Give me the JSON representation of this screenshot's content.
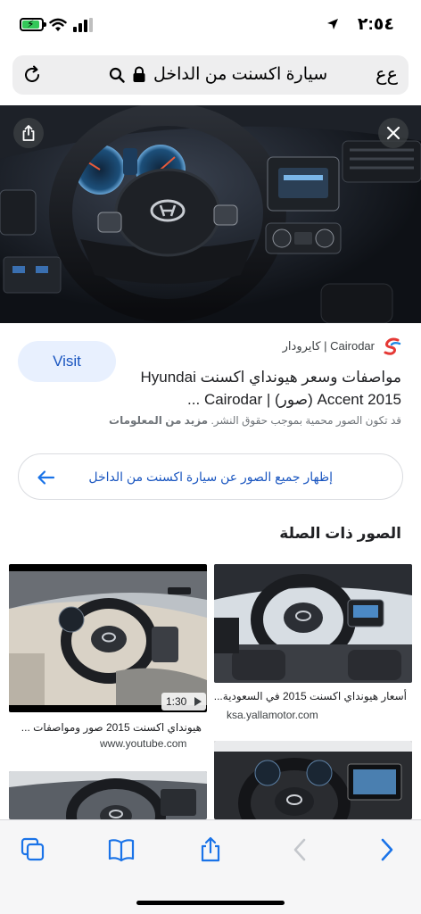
{
  "status_bar": {
    "time": "٢:٥٤",
    "icons": [
      "location-arrow-icon",
      "battery-charging-icon",
      "wifi-icon",
      "cellular-signal-icon"
    ]
  },
  "url_bar": {
    "text_size_label": "ﻉﻉ",
    "query": "سيارة اكسنت من الداخل",
    "icons": [
      "lock-icon",
      "search-icon",
      "reload-icon"
    ]
  },
  "hero": {
    "description_icons": [
      "share-icon",
      "close-icon"
    ]
  },
  "result": {
    "source_name": "Cairodar | كايرودار",
    "title_line1": "مواصفات وسعر هيونداي اكسنت Hyundai",
    "title_line2": "Accent 2015 (صور) | Cairodar ...",
    "copyright_text": "قد تكون الصور محمية بموجب حقوق النشر.",
    "more_info": "مزيد من المعلومات",
    "visit_label": "Visit"
  },
  "show_all": {
    "label": "إظهار جميع الصور عن سيارة اكسنت من الداخل"
  },
  "related": {
    "heading": "الصور ذات الصلة",
    "items": [
      {
        "title": "أسعار هيونداي اكسنت 2015 في السعودية...",
        "source": "ksa.yallamotor.com"
      },
      {
        "title": "هيونداي اكسنت 2015 صور ومواصفات ...",
        "source": "www.youtube.com",
        "duration": "1:30"
      },
      {
        "title": "",
        "source": ""
      },
      {
        "title": "",
        "source": ""
      }
    ]
  },
  "toolbar": {
    "items": [
      "tabs-icon",
      "bookmarks-icon",
      "share-icon",
      "back-icon",
      "forward-icon"
    ]
  },
  "colors": {
    "accent": "#1a56c0",
    "visit_bg": "#e8f0fe",
    "url_bar_bg": "#eeeeef",
    "safari_blue": "#1a73e8"
  }
}
